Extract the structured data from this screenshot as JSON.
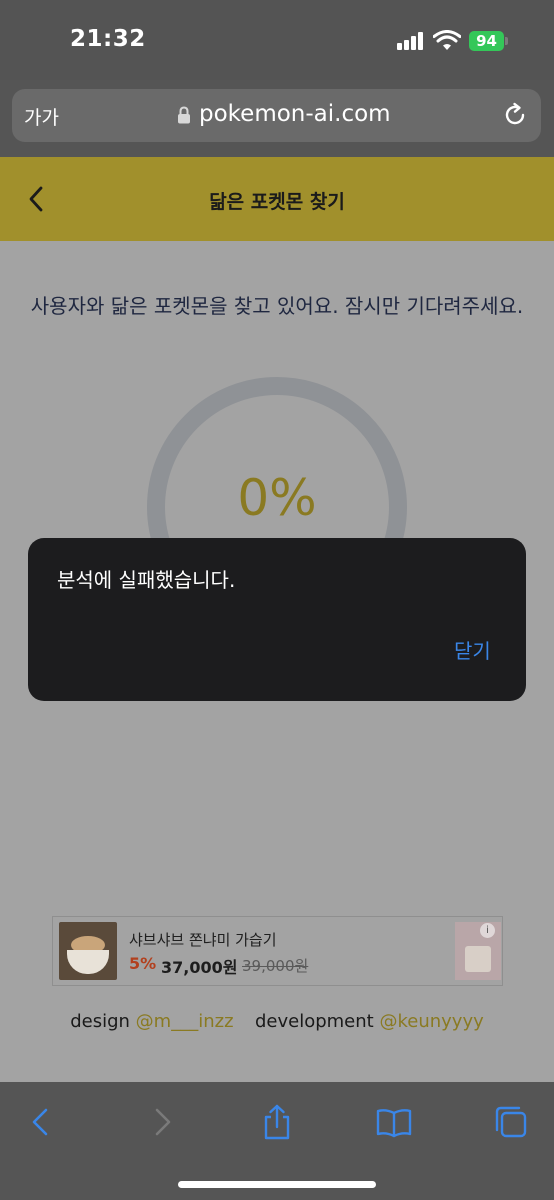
{
  "status_bar": {
    "time": "21:32",
    "battery": "94"
  },
  "browser": {
    "text_size_label": "가가",
    "url": "pokemon-ai.com"
  },
  "header": {
    "title": "닮은 포켓몬 찾기"
  },
  "content": {
    "loading_message": "사용자와 닮은 포켓몬을 찾고 있어요. 잠시만 기다려주세요.",
    "progress_text": "0%",
    "progress_value": 0
  },
  "ad": {
    "title": "샤브샤브 쫀냐미 가습기",
    "discount": "5%",
    "price": "37,000원",
    "original_price": "39,000원",
    "info_badge": "i"
  },
  "credits": {
    "design_label": "design",
    "design_handle": "@m___inzz",
    "dev_label": "development",
    "dev_handle": "@keunyyyy"
  },
  "alert": {
    "message": "분석에 실패했습니다.",
    "close_label": "닫기"
  },
  "colors": {
    "header_bg": "#a1902c",
    "accent_gold": "#8a7a22",
    "alert_bg": "#1c1c1e",
    "link_blue": "#3a86e8",
    "battery_green": "#34c759"
  },
  "icons": [
    "signal-icon",
    "wifi-icon",
    "lock-icon",
    "reload-icon",
    "back-chevron-icon",
    "toolbar-back-icon",
    "toolbar-forward-icon",
    "share-icon",
    "bookmarks-icon",
    "tabs-icon"
  ]
}
